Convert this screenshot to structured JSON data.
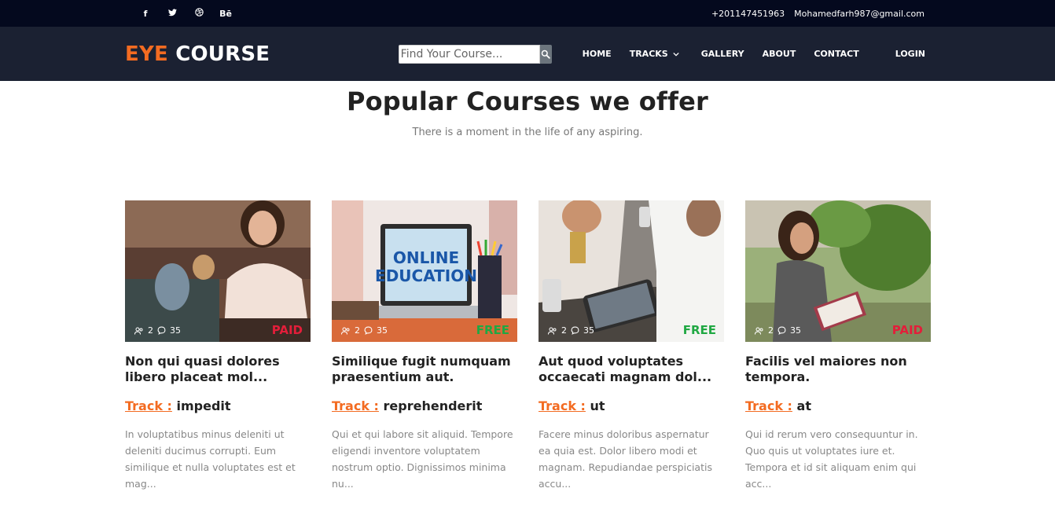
{
  "topbar": {
    "social": [
      {
        "icon": "facebook-icon",
        "glyph": "f"
      },
      {
        "icon": "twitter-icon",
        "glyph": "🐦"
      },
      {
        "icon": "dribbble-icon",
        "glyph": "◎"
      },
      {
        "icon": "behance-icon",
        "glyph": "Bē"
      }
    ],
    "phone": "+201147451963",
    "email": "Mohamedfarh987@gmail.com"
  },
  "navbar": {
    "logo_part1": "EYE",
    "logo_part2": "COURSE",
    "search_placeholder": "Find Your Course...",
    "menu": {
      "home": "HOME",
      "tracks": "TRACKS",
      "gallery": "GALLERY",
      "about": "ABOUT",
      "contact": "CONTACT",
      "login": "LOGIN"
    }
  },
  "section": {
    "title": "Popular Courses we offer",
    "subtitle": "There is a moment in the life of any aspiring."
  },
  "courses": [
    {
      "users": "2",
      "comments": "35",
      "price": "PAID",
      "title": "Non qui quasi dolores libero placeat mol...",
      "track_label": "Track :",
      "track": "impedit",
      "description": "In voluptatibus minus deleniti ut deleniti ducimus corrupti. Eum similique et nulla voluptates est et mag..."
    },
    {
      "users": "2",
      "comments": "35",
      "price": "FREE",
      "title": "Similique fugit numquam praesentium aut.",
      "track_label": "Track :",
      "track": "reprehenderit",
      "description": "Qui et qui labore sit aliquid. Tempore eligendi inventore voluptatem nostrum optio. Dignissimos minima nu..."
    },
    {
      "users": "2",
      "comments": "35",
      "price": "FREE",
      "title": "Aut quod voluptates occaecati magnam dol...",
      "track_label": "Track :",
      "track": "ut",
      "description": "Facere minus doloribus aspernatur ea quia est. Dolor libero modi et magnam. Repudiandae perspiciatis accu..."
    },
    {
      "users": "2",
      "comments": "35",
      "price": "PAID",
      "title": "Facilis vel maiores non tempora.",
      "track_label": "Track :",
      "track": "at",
      "description": "Qui id rerum vero consequuntur in. Quo quis ut voluptates iure et. Tempora et id sit aliquam enim qui acc..."
    }
  ],
  "image_text": {
    "laptop_line1": "ONLINE",
    "laptop_line2": "EDUCATION"
  },
  "colors": {
    "accent": "#f36b21",
    "topbar_bg": "#04091e",
    "navbar_bg": "#1b2132",
    "paid": "#e31e3a",
    "free": "#20a843"
  }
}
